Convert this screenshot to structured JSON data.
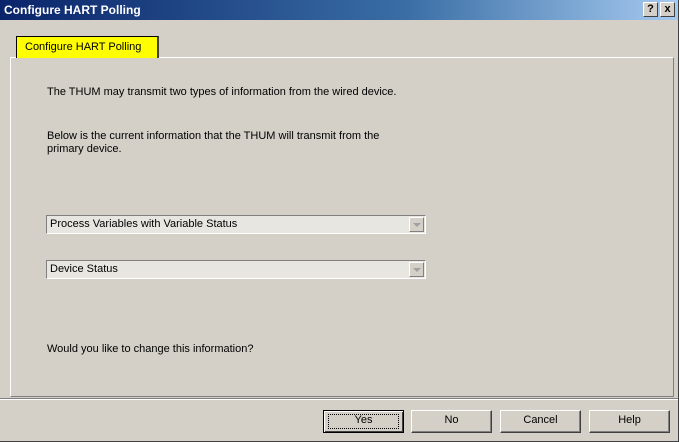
{
  "window": {
    "title": "Configure HART Polling",
    "help_button": "?",
    "close_button": "x"
  },
  "tab": {
    "label": "Configure HART Polling"
  },
  "content": {
    "intro": "The THUM may transmit two types of information from the wired device.",
    "current": "Below is the current information that the THUM will transmit from the primary device.",
    "combo1_value": "Process Variables with Variable Status",
    "combo2_value": "Device Status",
    "question": "Would you like to change this information?"
  },
  "buttons": {
    "yes": "Yes",
    "no": "No",
    "cancel": "Cancel",
    "help": "Help"
  },
  "colors": {
    "titlebar_start": "#0a246a",
    "titlebar_end": "#a6caf0",
    "tab_highlight": "#ffff00",
    "dialog_bg": "#d4d0c8"
  }
}
